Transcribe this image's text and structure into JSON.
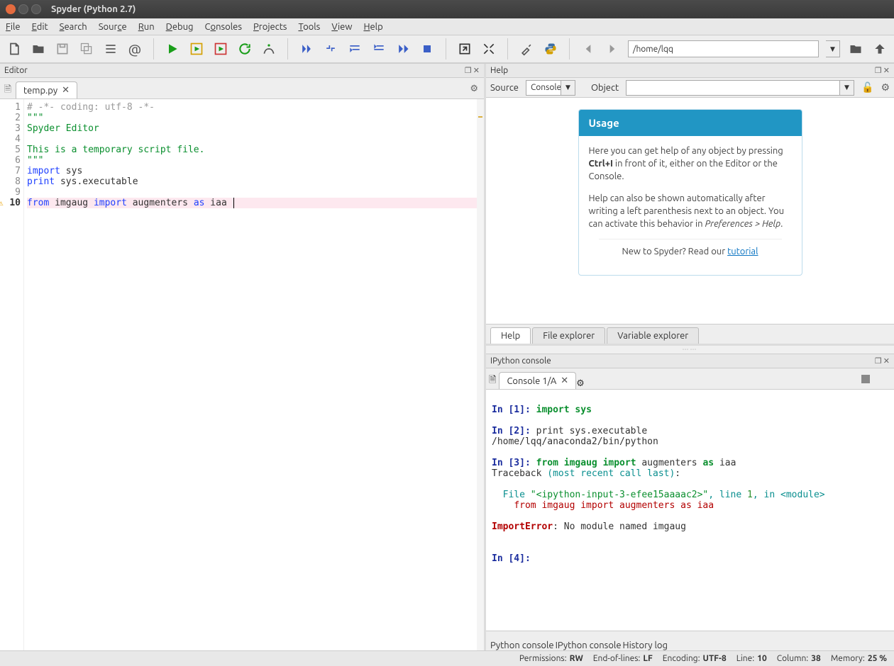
{
  "window": {
    "title": "Spyder (Python 2.7)"
  },
  "menu": {
    "file": "File",
    "edit": "Edit",
    "search": "Search",
    "source": "Source",
    "run": "Run",
    "debug": "Debug",
    "consoles": "Consoles",
    "projects": "Projects",
    "tools": "Tools",
    "view": "View",
    "help": "Help"
  },
  "toolbar": {
    "path": "/home/lqq"
  },
  "editor": {
    "pane_title": "Editor",
    "tab_name": "temp.py",
    "lines": [
      {
        "n": "1",
        "raw": "# -*- coding: utf-8 -*-",
        "cls": "c-gray"
      },
      {
        "n": "2",
        "raw": "\"\"\"",
        "cls": "c-green"
      },
      {
        "n": "3",
        "raw": "Spyder Editor",
        "cls": "c-green"
      },
      {
        "n": "4",
        "raw": "",
        "cls": ""
      },
      {
        "n": "5",
        "raw": "This is a temporary script file.",
        "cls": "c-green"
      },
      {
        "n": "6",
        "raw": "\"\"\"",
        "cls": "c-green"
      },
      {
        "n": "7",
        "raw": "import sys",
        "cls": ""
      },
      {
        "n": "8",
        "raw": "print sys.executable",
        "cls": ""
      },
      {
        "n": "9",
        "raw": "",
        "cls": ""
      },
      {
        "n": "10",
        "raw": "from imgaug import augmenters as iaa ",
        "cls": "",
        "hl": true,
        "warn": true,
        "cursor": true
      }
    ]
  },
  "help": {
    "pane_title": "Help",
    "source_label": "Source",
    "source_value": "Console",
    "object_label": "Object",
    "object_value": "",
    "card_title": "Usage",
    "card_p1a": "Here you can get help of any object by pressing ",
    "card_p1b": "Ctrl+I",
    "card_p1c": " in front of it, either on the Editor or the Console.",
    "card_p2a": "Help can also be shown automatically after writing a left parenthesis next to an object. You can activate this behavior in ",
    "card_p2b": "Preferences > Help",
    "card_p2c": ".",
    "card_foot_a": "New to Spyder? Read our ",
    "card_foot_link": "tutorial",
    "tabs": {
      "help": "Help",
      "fe": "File explorer",
      "ve": "Variable explorer"
    }
  },
  "ipy": {
    "pane_title": "IPython console",
    "tab_name": "Console 1/A",
    "bottom_tabs": {
      "py": "Python console",
      "ipy": "IPython console",
      "hist": "History log"
    }
  },
  "console": {
    "in1_label": "In [1]: ",
    "in1_code_a": "import ",
    "in1_code_b": "sys",
    "in2_label": "In [2]: ",
    "in2_code": "print sys.executable",
    "in2_out": "/home/lqq/anaconda2/bin/python",
    "in3_label": "In [3]: ",
    "in3_code_a": "from ",
    "in3_code_b": "imgaug ",
    "in3_code_c": "import ",
    "in3_code_d": "augmenters ",
    "in3_code_e": "as ",
    "in3_code_f": "iaa",
    "tb": "Traceback ",
    "tb2": "(most recent call last)",
    "tb3": ":",
    "file_a": "  File ",
    "file_b": "\"<ipython-input-3-efee15aaaac2>\"",
    "file_c": ", line ",
    "file_d": "1",
    "file_e": ", in ",
    "file_f": "<module>",
    "file_line": "    from imgaug import augmenters as iaa",
    "err_a": "ImportError",
    "err_b": ": No module named imgaug",
    "in4_label": "In [4]: "
  },
  "status": {
    "perm_l": "Permissions:",
    "perm_v": "RW",
    "eol_l": "End-of-lines:",
    "eol_v": "LF",
    "enc_l": "Encoding:",
    "enc_v": "UTF-8",
    "line_l": "Line:",
    "line_v": "10",
    "col_l": "Column:",
    "col_v": "38",
    "mem_l": "Memory:",
    "mem_v": "25 %"
  }
}
